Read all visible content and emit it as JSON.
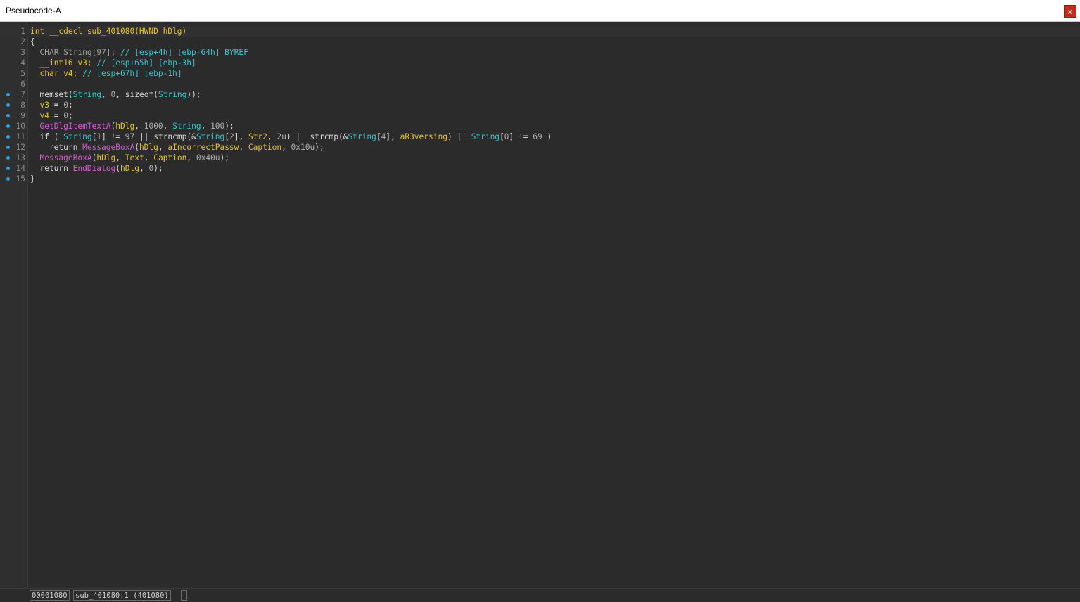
{
  "window": {
    "title": "Pseudocode-A",
    "close_label": "x"
  },
  "colors": {
    "background": "#2b2b2b",
    "type_keyword": "#e8c22c",
    "comment_and_var": "#2dc9d0",
    "api_call": "#d45ad8",
    "breakpoint_dot": "#29a3e6"
  },
  "code_lines": [
    {
      "number": "1",
      "has_dot": false,
      "tokens": [
        {
          "t": "int __cdecl sub_401080(HWND hDlg)",
          "c": "yellow"
        }
      ]
    },
    {
      "number": "2",
      "has_dot": false,
      "tokens": [
        {
          "t": "{",
          "c": "plain"
        }
      ]
    },
    {
      "number": "3",
      "has_dot": false,
      "tokens": [
        {
          "t": "  ",
          "c": "plain"
        },
        {
          "t": "CHAR String[97];",
          "c": "muted"
        },
        {
          "t": " // [esp+4h] [ebp-64h] BYREF",
          "c": "cyan"
        }
      ]
    },
    {
      "number": "4",
      "has_dot": false,
      "tokens": [
        {
          "t": "  ",
          "c": "plain"
        },
        {
          "t": "__int16 v3;",
          "c": "yellow"
        },
        {
          "t": " // [esp+65h] [ebp-3h]",
          "c": "cyan"
        }
      ]
    },
    {
      "number": "5",
      "has_dot": false,
      "tokens": [
        {
          "t": "  ",
          "c": "plain"
        },
        {
          "t": "char v4;",
          "c": "yellow"
        },
        {
          "t": " // [esp+67h] [ebp-1h]",
          "c": "cyan"
        }
      ]
    },
    {
      "number": "6",
      "has_dot": false,
      "tokens": []
    },
    {
      "number": "7",
      "has_dot": true,
      "tokens": [
        {
          "t": "  memset(",
          "c": "plain"
        },
        {
          "t": "String",
          "c": "cyan"
        },
        {
          "t": ", ",
          "c": "plain"
        },
        {
          "t": "0",
          "c": "num"
        },
        {
          "t": ", sizeof(",
          "c": "plain"
        },
        {
          "t": "String",
          "c": "cyan"
        },
        {
          "t": "));",
          "c": "plain"
        }
      ]
    },
    {
      "number": "8",
      "has_dot": true,
      "tokens": [
        {
          "t": "  ",
          "c": "plain"
        },
        {
          "t": "v3",
          "c": "yellow"
        },
        {
          "t": " = ",
          "c": "plain"
        },
        {
          "t": "0",
          "c": "num"
        },
        {
          "t": ";",
          "c": "plain"
        }
      ]
    },
    {
      "number": "9",
      "has_dot": true,
      "tokens": [
        {
          "t": "  ",
          "c": "plain"
        },
        {
          "t": "v4",
          "c": "yellow"
        },
        {
          "t": " = ",
          "c": "plain"
        },
        {
          "t": "0",
          "c": "num"
        },
        {
          "t": ";",
          "c": "plain"
        }
      ]
    },
    {
      "number": "10",
      "has_dot": true,
      "tokens": [
        {
          "t": "  ",
          "c": "plain"
        },
        {
          "t": "GetDlgItemTextA",
          "c": "magenta"
        },
        {
          "t": "(",
          "c": "plain"
        },
        {
          "t": "hDlg",
          "c": "yellow"
        },
        {
          "t": ", ",
          "c": "plain"
        },
        {
          "t": "1000",
          "c": "num"
        },
        {
          "t": ", ",
          "c": "plain"
        },
        {
          "t": "String",
          "c": "cyan"
        },
        {
          "t": ", ",
          "c": "plain"
        },
        {
          "t": "100",
          "c": "num"
        },
        {
          "t": ");",
          "c": "plain"
        }
      ]
    },
    {
      "number": "11",
      "has_dot": true,
      "tokens": [
        {
          "t": "  if ( ",
          "c": "plain"
        },
        {
          "t": "String",
          "c": "cyan"
        },
        {
          "t": "[",
          "c": "plain"
        },
        {
          "t": "1",
          "c": "num"
        },
        {
          "t": "] != ",
          "c": "plain"
        },
        {
          "t": "97",
          "c": "num"
        },
        {
          "t": " || strncmp(&",
          "c": "plain"
        },
        {
          "t": "String",
          "c": "cyan"
        },
        {
          "t": "[",
          "c": "plain"
        },
        {
          "t": "2",
          "c": "num"
        },
        {
          "t": "], ",
          "c": "plain"
        },
        {
          "t": "Str2",
          "c": "yellow"
        },
        {
          "t": ", ",
          "c": "plain"
        },
        {
          "t": "2u",
          "c": "num"
        },
        {
          "t": ") || strcmp(&",
          "c": "plain"
        },
        {
          "t": "String",
          "c": "cyan"
        },
        {
          "t": "[",
          "c": "plain"
        },
        {
          "t": "4",
          "c": "num"
        },
        {
          "t": "], ",
          "c": "plain"
        },
        {
          "t": "aR3versing",
          "c": "yellow"
        },
        {
          "t": ") || ",
          "c": "plain"
        },
        {
          "t": "String",
          "c": "cyan"
        },
        {
          "t": "[",
          "c": "plain"
        },
        {
          "t": "0",
          "c": "num"
        },
        {
          "t": "] != ",
          "c": "plain"
        },
        {
          "t": "69",
          "c": "num"
        },
        {
          "t": " )",
          "c": "plain"
        }
      ]
    },
    {
      "number": "12",
      "has_dot": true,
      "tokens": [
        {
          "t": "    return ",
          "c": "plain"
        },
        {
          "t": "MessageBoxA",
          "c": "magenta"
        },
        {
          "t": "(",
          "c": "plain"
        },
        {
          "t": "hDlg",
          "c": "yellow"
        },
        {
          "t": ", ",
          "c": "plain"
        },
        {
          "t": "aIncorrectPassw",
          "c": "yellow"
        },
        {
          "t": ", ",
          "c": "plain"
        },
        {
          "t": "Caption",
          "c": "yellow"
        },
        {
          "t": ", ",
          "c": "plain"
        },
        {
          "t": "0x10u",
          "c": "num"
        },
        {
          "t": ");",
          "c": "plain"
        }
      ]
    },
    {
      "number": "13",
      "has_dot": true,
      "tokens": [
        {
          "t": "  ",
          "c": "plain"
        },
        {
          "t": "MessageBoxA",
          "c": "magenta"
        },
        {
          "t": "(",
          "c": "plain"
        },
        {
          "t": "hDlg",
          "c": "yellow"
        },
        {
          "t": ", ",
          "c": "plain"
        },
        {
          "t": "Text",
          "c": "yellow"
        },
        {
          "t": ", ",
          "c": "plain"
        },
        {
          "t": "Caption",
          "c": "yellow"
        },
        {
          "t": ", ",
          "c": "plain"
        },
        {
          "t": "0x40u",
          "c": "num"
        },
        {
          "t": ");",
          "c": "plain"
        }
      ]
    },
    {
      "number": "14",
      "has_dot": true,
      "tokens": [
        {
          "t": "  return ",
          "c": "plain"
        },
        {
          "t": "EndDialog",
          "c": "magenta"
        },
        {
          "t": "(",
          "c": "plain"
        },
        {
          "t": "hDlg",
          "c": "yellow"
        },
        {
          "t": ", ",
          "c": "plain"
        },
        {
          "t": "0",
          "c": "num"
        },
        {
          "t": ");",
          "c": "plain"
        }
      ]
    },
    {
      "number": "15",
      "has_dot": true,
      "tokens": [
        {
          "t": "}",
          "c": "plain"
        }
      ]
    }
  ],
  "status": {
    "address": "00001080",
    "location": "sub_401080:1 (401080)"
  }
}
